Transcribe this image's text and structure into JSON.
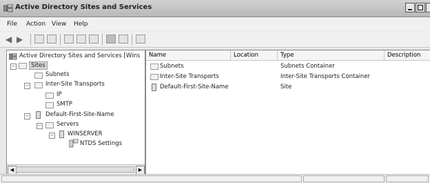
{
  "window": {
    "title": "Active Directory Sites and Services"
  },
  "menu": [
    "File",
    "Action",
    "View",
    "Help"
  ],
  "toolbar": {
    "icons": [
      "back-icon",
      "forward-icon",
      "up-icon",
      "show-tree-icon",
      "properties-icon",
      "refresh-icon",
      "export-icon",
      "help-icon",
      "console-tree-icon",
      "snapin-icon"
    ]
  },
  "tree": {
    "root": "Active Directory Sites and Services [Wins",
    "sites": "Sites",
    "subnets": "Subnets",
    "inter_site": "Inter-Site Transports",
    "ip": "IP",
    "smtp": "SMTP",
    "default_site": "Default-First-Site-Name",
    "servers": "Servers",
    "winserver": "WINSERVER",
    "ntds": "NTDS Settings"
  },
  "list": {
    "columns": [
      "Name",
      "Location",
      "Type",
      "Description"
    ],
    "rows": [
      {
        "name": "Subnets",
        "location": "",
        "type": "Subnets Container",
        "icon": "folder-icon"
      },
      {
        "name": "Inter-Site Transports",
        "location": "",
        "type": "Inter-Site Transports Container",
        "icon": "folder-icon"
      },
      {
        "name": "Default-First-Site-Name",
        "location": "",
        "type": "Site",
        "icon": "site-icon"
      }
    ]
  }
}
